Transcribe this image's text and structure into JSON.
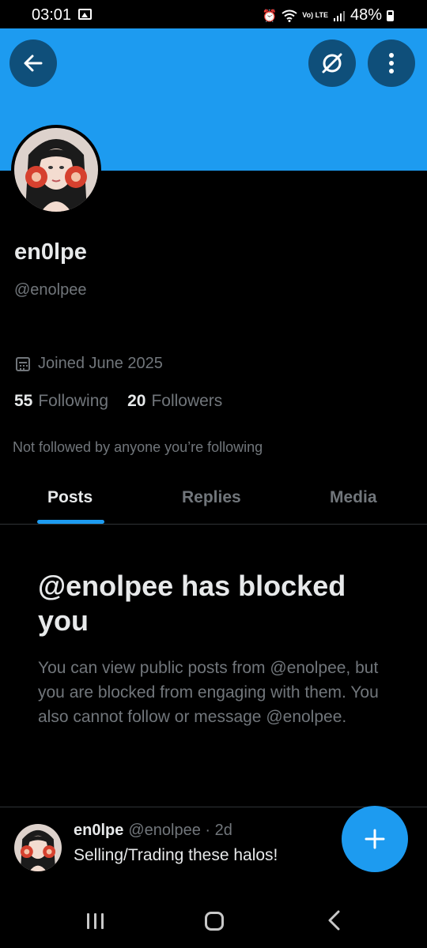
{
  "status_bar": {
    "time": "03:01",
    "battery": "48%",
    "network": "Vo) LTE",
    "icons": [
      "gallery-icon",
      "alarm-icon",
      "wifi-icon",
      "signal-icon",
      "battery-icon"
    ]
  },
  "header": {
    "banner_color": "#1d9bf0",
    "icons": [
      "back-arrow-icon",
      "grok-icon",
      "more-vertical-icon"
    ]
  },
  "profile": {
    "display_name": "en0lpe",
    "handle": "@enolpee",
    "joined": "Joined June 2025",
    "following_count": "55",
    "following_label": "Following",
    "followers_count": "20",
    "followers_label": "Followers",
    "not_followed_note": "Not followed by anyone you’re following"
  },
  "tabs": [
    {
      "label": "Posts",
      "active": true
    },
    {
      "label": "Replies",
      "active": false
    },
    {
      "label": "Media",
      "active": false
    }
  ],
  "blocked": {
    "title": "@enolpee has blocked you",
    "description": "You can view public posts from @enolpee, but you are blocked from engaging with them. You also cannot follow or message @enolpee."
  },
  "post": {
    "author_name": "en0lpe",
    "author_handle": "@enolpee",
    "time": "· 2d",
    "text": "Selling/Trading these halos!"
  },
  "fab": {
    "icon": "plus-icon",
    "color": "#1d9bf0"
  },
  "colors": {
    "accent": "#1d9bf0",
    "background": "#000000",
    "secondary_text": "#71767b"
  }
}
